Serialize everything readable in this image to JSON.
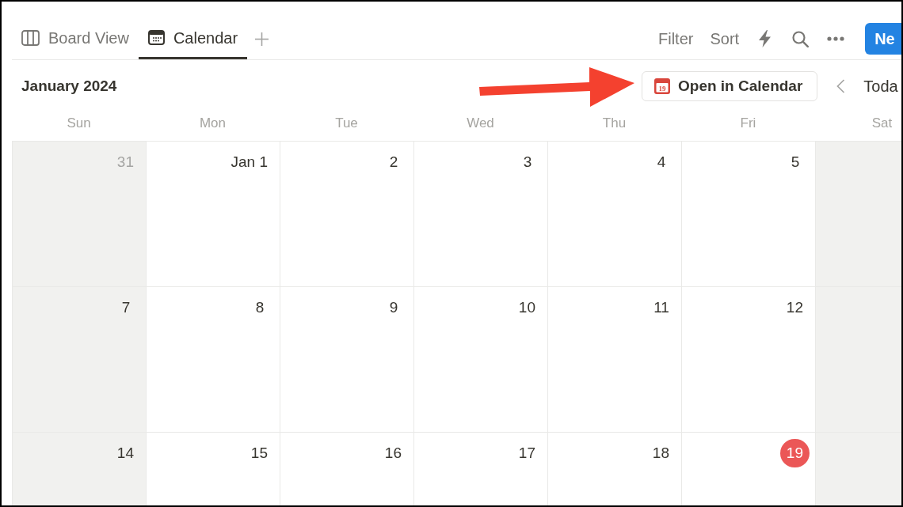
{
  "tabs": [
    {
      "label": "Board View",
      "kind": "board",
      "selected": false
    },
    {
      "label": "Calendar",
      "kind": "calendar",
      "selected": true
    }
  ],
  "toolbar": {
    "filter": "Filter",
    "sort": "Sort",
    "new_button": "Ne"
  },
  "calendar_header": {
    "month": "January 2024",
    "open_button": {
      "label": "Open in Calendar",
      "icon_text": "19"
    },
    "today_button": "Toda"
  },
  "weekdays": [
    {
      "label": "Sun",
      "weekend": true
    },
    {
      "label": "Mon",
      "weekend": false
    },
    {
      "label": "Tue",
      "weekend": false
    },
    {
      "label": "Wed",
      "weekend": false
    },
    {
      "label": "Thu",
      "weekend": false
    },
    {
      "label": "Fri",
      "weekend": false
    },
    {
      "label": "Sat",
      "weekend": true
    }
  ],
  "weeks": [
    {
      "days": [
        {
          "label": "31",
          "outside_month": true,
          "today": false
        },
        {
          "label": "Jan 1",
          "outside_month": false,
          "today": false
        },
        {
          "label": "2",
          "outside_month": false,
          "today": false
        },
        {
          "label": "3",
          "outside_month": false,
          "today": false
        },
        {
          "label": "4",
          "outside_month": false,
          "today": false
        },
        {
          "label": "5",
          "outside_month": false,
          "today": false
        }
      ]
    },
    {
      "days": [
        {
          "label": "7",
          "outside_month": false,
          "today": false
        },
        {
          "label": "8",
          "outside_month": false,
          "today": false
        },
        {
          "label": "9",
          "outside_month": false,
          "today": false
        },
        {
          "label": "10",
          "outside_month": false,
          "today": false
        },
        {
          "label": "11",
          "outside_month": false,
          "today": false
        },
        {
          "label": "12",
          "outside_month": false,
          "today": false
        }
      ]
    },
    {
      "days": [
        {
          "label": "14",
          "outside_month": false,
          "today": false
        },
        {
          "label": "15",
          "outside_month": false,
          "today": false
        },
        {
          "label": "16",
          "outside_month": false,
          "today": false
        },
        {
          "label": "17",
          "outside_month": false,
          "today": false
        },
        {
          "label": "18",
          "outside_month": false,
          "today": false
        },
        {
          "label": "19",
          "outside_month": false,
          "today": true
        }
      ]
    }
  ]
}
